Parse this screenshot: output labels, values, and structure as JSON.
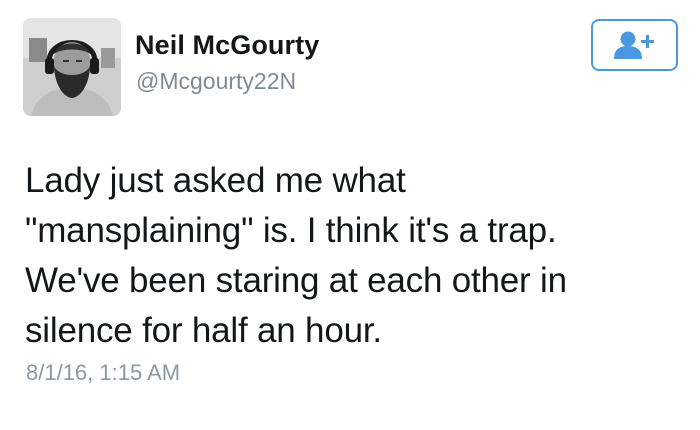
{
  "author": {
    "display_name": "Neil McGourty",
    "handle": "@Mcgourty22N",
    "avatar_icon": "profile-photo"
  },
  "follow_button": {
    "icon": "follow-person-plus-icon",
    "accent_color": "#4a98e0"
  },
  "tweet": {
    "text_lines": [
      "Lady just asked me what",
      "\"mansplaining\" is. I think it's a trap.",
      "We've been staring at each other in",
      "silence for half an hour."
    ],
    "timestamp": "8/1/16, 1:15 AM"
  },
  "colors": {
    "text": "#14171a",
    "secondary_text": "#7f8a94",
    "background": "#ffffff"
  }
}
